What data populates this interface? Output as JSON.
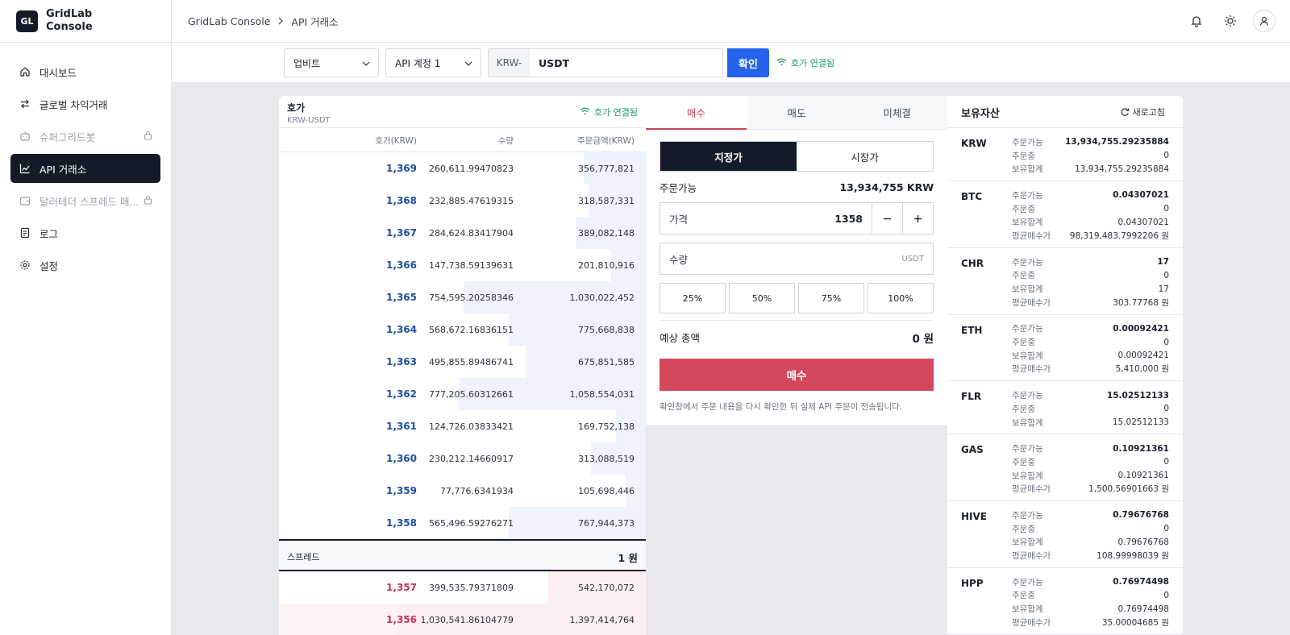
{
  "brand": {
    "logo": "GL",
    "name": "GridLab Console"
  },
  "sidebar": {
    "items": [
      {
        "label": "대시보드",
        "icon": "home-icon",
        "state": "normal"
      },
      {
        "label": "글로벌 차익거래",
        "icon": "arrows-icon",
        "state": "normal"
      },
      {
        "label": "슈퍼그리드봇",
        "icon": "bot-icon",
        "state": "disabled",
        "lock": true
      },
      {
        "label": "API 거래소",
        "icon": "chart-line-icon",
        "state": "active"
      },
      {
        "label": "달러테더 스프레드 매...",
        "icon": "wallet-icon",
        "state": "disabled",
        "lock": true
      },
      {
        "label": "로그",
        "icon": "log-icon",
        "state": "normal"
      },
      {
        "label": "설정",
        "icon": "gear-icon",
        "state": "normal"
      }
    ]
  },
  "header": {
    "breadcrumb": [
      "GridLab Console",
      "API 거래소"
    ],
    "icons": [
      "bell-icon",
      "sun-icon",
      "user-icon"
    ]
  },
  "toolbar": {
    "exchange": "업비트",
    "account": "API 계정 1",
    "market_prefix": "KRW-",
    "market_value": "USDT",
    "confirm_label": "확인",
    "status": "호가 연결됨"
  },
  "orderbook": {
    "title": "호가",
    "subtitle": "KRW-USDT",
    "status": "호가 연결됨",
    "columns": [
      "호가(KRW)",
      "수량",
      "주문금액(KRW)"
    ],
    "asks": [
      {
        "price": "1,369",
        "qty": "260,611.99470823",
        "amount": "356,777,821",
        "depth": 0.25
      },
      {
        "price": "1,368",
        "qty": "232,885.47619315",
        "amount": "318,587,331",
        "depth": 0.23
      },
      {
        "price": "1,367",
        "qty": "284,624.83417904",
        "amount": "389,082,148",
        "depth": 0.28
      },
      {
        "price": "1,366",
        "qty": "147,738.59139631",
        "amount": "201,810,916",
        "depth": 0.14
      },
      {
        "price": "1,365",
        "qty": "754,595.20258346",
        "amount": "1,030,022,452",
        "depth": 0.73
      },
      {
        "price": "1,364",
        "qty": "568,672.16836151",
        "amount": "775,668,838",
        "depth": 0.55
      },
      {
        "price": "1,363",
        "qty": "495,855.89486741",
        "amount": "675,851,585",
        "depth": 0.48
      },
      {
        "price": "1,362",
        "qty": "777,205.60312661",
        "amount": "1,058,554,031",
        "depth": 0.75
      },
      {
        "price": "1,361",
        "qty": "124,726.03833421",
        "amount": "169,752,138",
        "depth": 0.12
      },
      {
        "price": "1,360",
        "qty": "230,212.14660917",
        "amount": "313,088,519",
        "depth": 0.22
      },
      {
        "price": "1,359",
        "qty": "77,776.6341934",
        "amount": "105,698,446",
        "depth": 0.08
      },
      {
        "price": "1,358",
        "qty": "565,496.59276271",
        "amount": "767,944,373",
        "depth": 0.55
      }
    ],
    "spread_label": "스프레드",
    "spread_value": "1 원",
    "bids": [
      {
        "price": "1,357",
        "qty": "399,535.79371809",
        "amount": "542,170,072",
        "depth": 0.39
      },
      {
        "price": "1,356",
        "qty": "1,030,541.86104779",
        "amount": "1,397,414,764",
        "depth": 1.0
      }
    ]
  },
  "order_form": {
    "tabs": [
      "매수",
      "매도",
      "미체결"
    ],
    "types": [
      "지정가",
      "시장가"
    ],
    "available_label": "주문가능",
    "available_value": "13,934,755 KRW",
    "price_label": "가격",
    "price_value": "1358",
    "qty_label": "수량",
    "qty_unit": "USDT",
    "percents": [
      "25%",
      "50%",
      "75%",
      "100%"
    ],
    "estimate_label": "예상 총액",
    "estimate_value": "0 원",
    "submit_label": "매수",
    "note": "확인창에서 주문 내용을 다시 확인한 뒤 실제 API 주문이 전송됩니다.",
    "colors": {
      "buy": "#d4485e",
      "active_type": "#141a27"
    }
  },
  "holdings": {
    "title": "보유자산",
    "refresh_label": "새로고침",
    "assets": [
      {
        "symbol": "KRW",
        "rows": [
          [
            "주문가능",
            "13,934,755.29235884"
          ],
          [
            "주문중",
            "0"
          ],
          [
            "보유합계",
            "13,934,755.29235884"
          ]
        ]
      },
      {
        "symbol": "BTC",
        "rows": [
          [
            "주문가능",
            "0.04307021"
          ],
          [
            "주문중",
            "0"
          ],
          [
            "보유합계",
            "0.04307021"
          ],
          [
            "평균매수가",
            "98,319,483.7992206 원"
          ]
        ]
      },
      {
        "symbol": "CHR",
        "rows": [
          [
            "주문가능",
            "17"
          ],
          [
            "주문중",
            "0"
          ],
          [
            "보유합계",
            "17"
          ],
          [
            "평균매수가",
            "303.77768 원"
          ]
        ]
      },
      {
        "symbol": "ETH",
        "rows": [
          [
            "주문가능",
            "0.00092421"
          ],
          [
            "주문중",
            "0"
          ],
          [
            "보유합계",
            "0.00092421"
          ],
          [
            "평균매수가",
            "5,410,000 원"
          ]
        ]
      },
      {
        "symbol": "FLR",
        "rows": [
          [
            "주문가능",
            "15.02512133"
          ],
          [
            "주문중",
            "0"
          ],
          [
            "보유합계",
            "15.02512133"
          ]
        ]
      },
      {
        "symbol": "GAS",
        "rows": [
          [
            "주문가능",
            "0.10921361"
          ],
          [
            "주문중",
            "0"
          ],
          [
            "보유합계",
            "0.10921361"
          ],
          [
            "평균매수가",
            "1,500.56901663 원"
          ]
        ]
      },
      {
        "symbol": "HIVE",
        "rows": [
          [
            "주문가능",
            "0.79676768"
          ],
          [
            "주문중",
            "0"
          ],
          [
            "보유합계",
            "0.79676768"
          ],
          [
            "평균매수가",
            "108.99998039 원"
          ]
        ]
      },
      {
        "symbol": "HPP",
        "rows": [
          [
            "주문가능",
            "0.76974498"
          ],
          [
            "주문중",
            "0"
          ],
          [
            "보유합계",
            "0.76974498"
          ],
          [
            "평균매수가",
            "35.00004685 원"
          ]
        ]
      }
    ]
  }
}
